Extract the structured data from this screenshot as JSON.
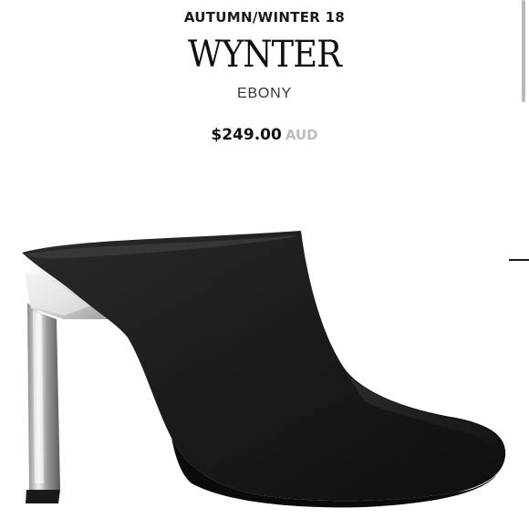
{
  "product": {
    "collection": "AUTUMN/WINTER 18",
    "name": "WYNTER",
    "colour": "EBONY",
    "price": "$249.00",
    "currency": "AUD"
  },
  "image": {
    "icon": "black-leather-mule-heel",
    "colors": {
      "leather": "#1b1b1b",
      "metal_heel": "#c9c9c9"
    }
  }
}
